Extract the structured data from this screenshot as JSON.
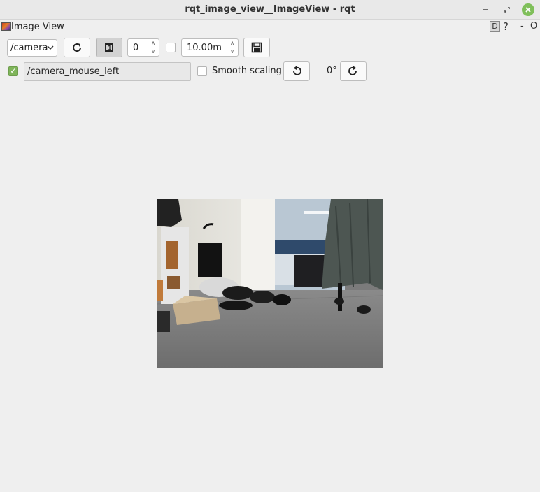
{
  "window": {
    "title": "rqt_image_view__ImageView - rqt"
  },
  "plugin": {
    "title": "Image View",
    "d_label": "D",
    "help_label": "?",
    "minimize_label": "-",
    "options_label": "O"
  },
  "toolbar": {
    "topic_combo_value": "/camera",
    "refresh_icon": "refresh-icon",
    "zoom_one_icon": "zoom-one-icon",
    "spin_value": "0",
    "dynamic_range_checked": false,
    "max_range_value": "10.00m",
    "save_icon": "save-icon"
  },
  "toolbar2": {
    "publish_checked": true,
    "publish_topic": "/camera_mouse_left",
    "smooth_scaling_label": "Smooth scaling",
    "smooth_scaling_checked": false,
    "rotate_left_icon": "rotate-left-icon",
    "rotation_label": "0°",
    "rotate_right_icon": "rotate-right-icon"
  },
  "image": {
    "description_icon": "camera-image"
  },
  "colors": {
    "background": "#efefef",
    "close_button": "#7fbf5a",
    "check_on": "#7fb55a"
  }
}
